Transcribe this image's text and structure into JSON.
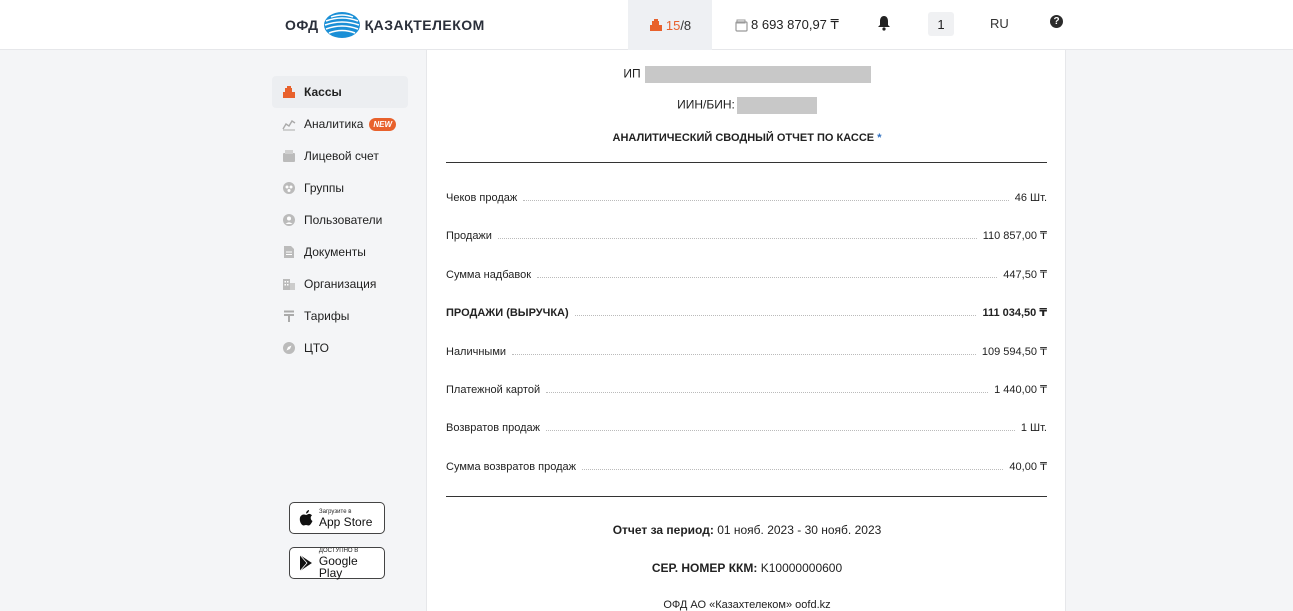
{
  "header": {
    "logo_left": "ОФД",
    "logo_right": "ҚАЗАҚТЕЛЕКОМ",
    "kassa_current": "15",
    "kassa_total": "/8",
    "balance": "8 693 870,97 ₸",
    "notifications_count": "1",
    "language": "RU",
    "help": "?"
  },
  "sidebar": {
    "items": [
      {
        "label": "Кассы",
        "icon": "cash-register-icon",
        "active": true
      },
      {
        "label": "Аналитика",
        "icon": "analytics-icon",
        "badge": "NEW"
      },
      {
        "label": "Лицевой счет",
        "icon": "wallet-icon"
      },
      {
        "label": "Группы",
        "icon": "groups-icon"
      },
      {
        "label": "Пользователи",
        "icon": "user-icon"
      },
      {
        "label": "Документы",
        "icon": "document-icon"
      },
      {
        "label": "Организация",
        "icon": "building-icon"
      },
      {
        "label": "Тарифы",
        "icon": "tenge-icon"
      },
      {
        "label": "ЦТО",
        "icon": "compass-icon"
      }
    ],
    "app_store": {
      "small": "Загрузите в",
      "big": "App Store"
    },
    "google_play": {
      "small": "ДОСТУПНО В",
      "big": "Google Play"
    }
  },
  "report": {
    "ip_label": "ИП",
    "iin_label": "ИИН/БИН:",
    "title": "АНАЛИТИЧЕСКИЙ СВОДНЫЙ ОТЧЕТ ПО КАССЕ",
    "title_mark": "*",
    "rows": [
      {
        "label": "Чеков продаж",
        "value": "46 Шт."
      },
      {
        "label": "Продажи",
        "value": "110 857,00 ₸"
      },
      {
        "label": "Сумма надбавок",
        "value": "447,50 ₸"
      },
      {
        "label": "ПРОДАЖИ (ВЫРУЧКА)",
        "value": "111 034,50 ₸",
        "bold": true
      },
      {
        "label": "Наличными",
        "value": "109 594,50 ₸"
      },
      {
        "label": "Платежной картой",
        "value": "1 440,00 ₸"
      },
      {
        "label": "Возвратов продаж",
        "value": "1 Шт."
      },
      {
        "label": "Сумма возвратов продаж",
        "value": "40,00 ₸"
      }
    ],
    "period_label": "Отчет за период:",
    "period_value": "01 нояб. 2023 - 30 нояб. 2023",
    "serial_label": "СЕР. НОМЕР ККМ:",
    "serial_value": "K10000000600",
    "footer": "ОФД АО «Казахтелеком» oofd.kz"
  }
}
